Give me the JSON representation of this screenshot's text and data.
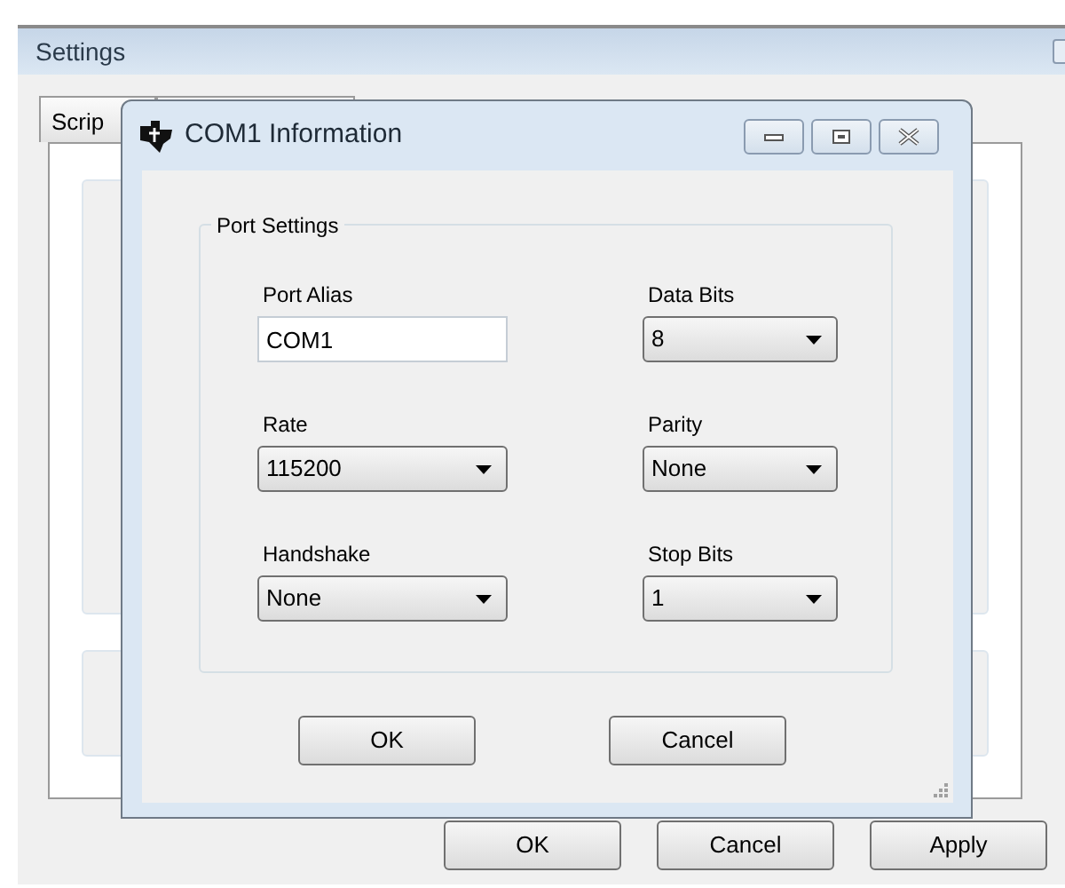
{
  "settings_window": {
    "title": "Settings",
    "tabs": [
      {
        "label": "Scrip"
      }
    ],
    "buttons": [
      {
        "label": "OK"
      },
      {
        "label": "Cancel"
      },
      {
        "label": "Apply"
      }
    ]
  },
  "dialog": {
    "title": "COM1 Information",
    "group_title": "Port Settings",
    "fields": [
      {
        "kind": "text",
        "label": "Port Alias",
        "value": "COM1"
      },
      {
        "kind": "dropdown",
        "label": "Data Bits",
        "value": "8"
      },
      {
        "kind": "dropdown",
        "label": "Rate",
        "value": "115200"
      },
      {
        "kind": "dropdown",
        "label": "Parity",
        "value": "None"
      },
      {
        "kind": "dropdown",
        "label": "Handshake",
        "value": "None"
      },
      {
        "kind": "dropdown",
        "label": "Stop Bits",
        "value": "1"
      }
    ],
    "buttons": [
      {
        "label": "OK"
      },
      {
        "label": "Cancel"
      }
    ]
  }
}
